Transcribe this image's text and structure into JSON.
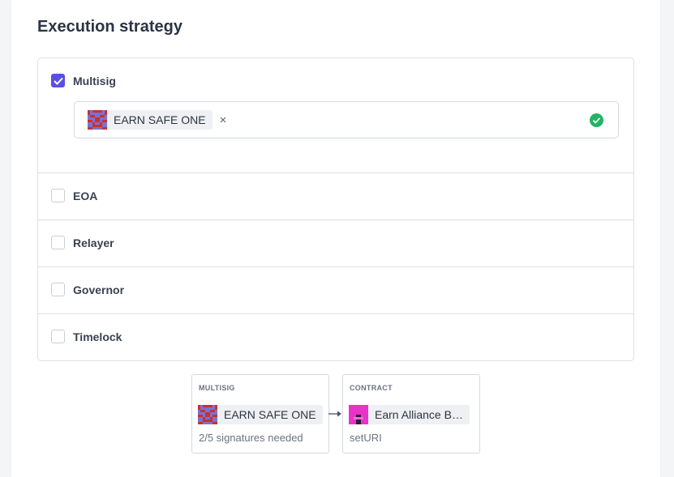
{
  "section": {
    "title": "Execution strategy"
  },
  "options": [
    {
      "label": "Multisig",
      "checked": true
    },
    {
      "label": "EOA",
      "checked": false
    },
    {
      "label": "Relayer",
      "checked": false
    },
    {
      "label": "Governor",
      "checked": false
    },
    {
      "label": "Timelock",
      "checked": false
    }
  ],
  "multisig_select": {
    "selected": "EARN SAFE ONE",
    "remove_label": "×",
    "valid": true
  },
  "flow": {
    "source": {
      "type": "MULTISIG",
      "name": "EARN SAFE ONE",
      "subtitle": "2/5 signatures needed"
    },
    "target": {
      "type": "CONTRACT",
      "name": "Earn Alliance B…",
      "subtitle": "setURI"
    }
  },
  "colors": {
    "accent": "#5b4ee6",
    "success": "#22b463",
    "border": "#dcdfe4"
  },
  "icons": [
    "check-icon",
    "close-icon",
    "success-check-icon",
    "arrow-right-icon",
    "safe-avatar-icon",
    "contract-avatar-icon"
  ]
}
